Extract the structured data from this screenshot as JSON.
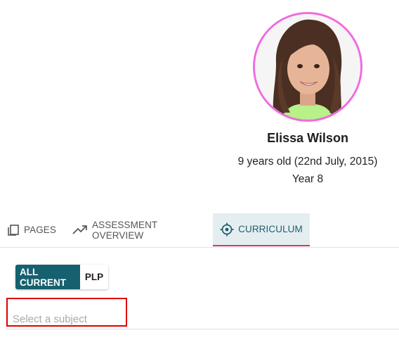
{
  "profile": {
    "name": "Elissa Wilson",
    "age_line": "9 years old (22nd July, 2015)",
    "year": "Year 8",
    "avatar_border_color": "#f06be0"
  },
  "tabs": [
    {
      "label": "PAGES",
      "icon": "pages-icon",
      "active": false
    },
    {
      "label": "ASSESSMENT OVERVIEW",
      "icon": "trending-up-icon",
      "active": false
    },
    {
      "label": "CURRICULUM",
      "icon": "target-icon",
      "active": true
    }
  ],
  "toggle": {
    "all_current": "ALL CURRENT",
    "plp": "PLP",
    "selected": "ALL CURRENT"
  },
  "subject": {
    "placeholder": "Select a subject",
    "value": ""
  },
  "colors": {
    "accent": "#16616f",
    "active_tab_bg": "#e4eef1",
    "active_tab_underline": "#d6336c",
    "highlight_box": "#e00000"
  }
}
